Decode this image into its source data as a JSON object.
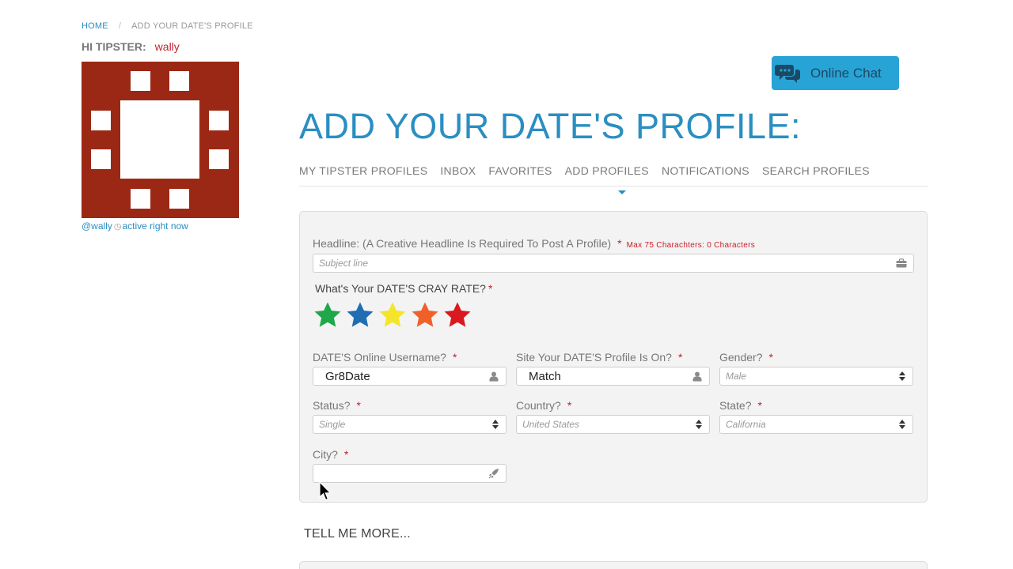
{
  "breadcrumb": {
    "home": "HOME",
    "separator": "/",
    "current": "ADD YOUR DATE'S PROFILE"
  },
  "greeting": {
    "label": "HI TIPSTER:",
    "username": "wally"
  },
  "presence": {
    "handle": "@wally",
    "status": "active right now",
    "icon": "clock-icon"
  },
  "chat": {
    "label": "Online Chat",
    "icon": "chat-bubbles-icon",
    "color": "#28a3d6"
  },
  "page_title": "ADD YOUR DATE'S PROFILE:",
  "nav": {
    "tabs": [
      {
        "label": "MY TIPSTER PROFILES"
      },
      {
        "label": "INBOX"
      },
      {
        "label": "FAVORITES"
      },
      {
        "label": "ADD PROFILES",
        "active": true
      },
      {
        "label": "NOTIFICATIONS"
      },
      {
        "label": "SEARCH PROFILES"
      }
    ]
  },
  "form": {
    "required_mark": "*",
    "headline": {
      "label": "Headline: (A Creative Headline Is Required To Post A Profile)",
      "note": "Max 75 Charachters: 0 Characters",
      "placeholder": "Subject line",
      "icon": "briefcase-icon"
    },
    "rate": {
      "label": "What's Your DATE'S CRAY RATE?",
      "stars": [
        {
          "color": "#1fa84a"
        },
        {
          "color": "#1f6db3"
        },
        {
          "color": "#f5e52a"
        },
        {
          "color": "#f0612a"
        },
        {
          "color": "#d9191f"
        }
      ]
    },
    "username": {
      "label": "DATE'S Online Username?",
      "value": "Gr8Date",
      "icon": "user-icon"
    },
    "site": {
      "label": "Site Your DATE'S Profile Is On?",
      "value": "Match",
      "icon": "user-icon"
    },
    "gender": {
      "label": "Gender?",
      "value": "Male"
    },
    "status": {
      "label": "Status?",
      "value": "Single"
    },
    "country": {
      "label": "Country?",
      "value": "United States"
    },
    "state": {
      "label": "State?",
      "value": "California"
    },
    "city": {
      "label": "City?",
      "value": "",
      "icon": "rocket-icon"
    }
  },
  "tell_more": "TELL ME MORE..."
}
